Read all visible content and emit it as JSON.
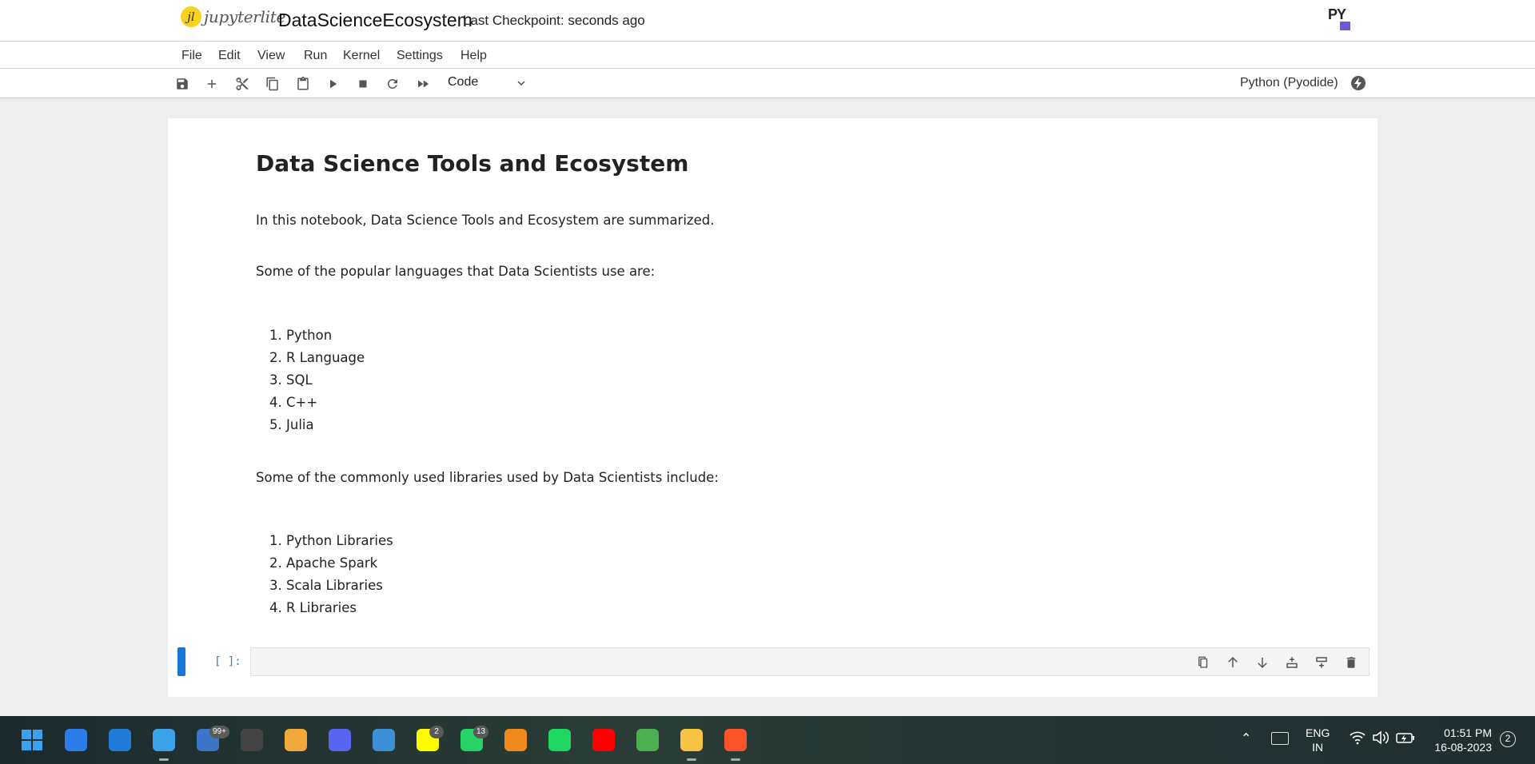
{
  "header": {
    "logo_mark": "jl",
    "logo_text": "jupyterlite",
    "notebook_title": "DataScienceEcosystem",
    "checkpoint": "Last Checkpoint: seconds ago",
    "pyodide_logo": "PY"
  },
  "menu": [
    "File",
    "Edit",
    "View",
    "Run",
    "Kernel",
    "Settings",
    "Help"
  ],
  "toolbar": {
    "buttons": [
      "save-icon",
      "add-icon",
      "cut-icon",
      "copy-icon",
      "paste-icon",
      "run-icon",
      "stop-icon",
      "restart-icon",
      "fast-forward-icon"
    ],
    "cell_type": "Code",
    "kernel": "Python (Pyodide)"
  },
  "notebook": {
    "heading": "Data Science Tools and Ecosystem",
    "intro": "In this notebook, Data Science Tools and Ecosystem are summarized.",
    "languages_intro": "Some of the popular languages that Data Scientists use are:",
    "languages": [
      "Python",
      "R Language",
      "SQL",
      "C++",
      "Julia"
    ],
    "libraries_intro": "Some of the commonly used libraries used by Data Scientists include:",
    "libraries": [
      "Python Libraries",
      "Apache Spark",
      "Scala Libraries",
      "R Libraries"
    ],
    "code_cell_prompt": "[ ]:"
  },
  "taskbar": {
    "apps": [
      {
        "name": "windows-start-icon",
        "color": "#3aa0f0"
      },
      {
        "name": "todo-icon",
        "color": "#2b7de9"
      },
      {
        "name": "mail-icon",
        "color": "#1f7ad9"
      },
      {
        "name": "photos-icon",
        "color": "#3aa3e8"
      },
      {
        "name": "teams-icon",
        "color": "#3c74c8",
        "badge": "99+"
      },
      {
        "name": "game-icon",
        "color": "#444444"
      },
      {
        "name": "video-icon",
        "color": "#f0a83a"
      },
      {
        "name": "discord-icon",
        "color": "#5865f2"
      },
      {
        "name": "remote-desktop-icon",
        "color": "#3d8fd6"
      },
      {
        "name": "snapchat-icon",
        "color": "#fffc00",
        "badge": "2"
      },
      {
        "name": "whatsapp-icon",
        "color": "#25d366",
        "badge": "13"
      },
      {
        "name": "vlc-icon",
        "color": "#f08a1c"
      },
      {
        "name": "spotify-icon",
        "color": "#1ed760"
      },
      {
        "name": "youtube-icon",
        "color": "#ff0000"
      },
      {
        "name": "chrome-icon",
        "color": "#4caf50"
      },
      {
        "name": "file-explorer-icon",
        "color": "#f6c343"
      },
      {
        "name": "brave-icon",
        "color": "#fb542b"
      }
    ],
    "language": "ENG",
    "region": "IN",
    "time": "01:51 PM",
    "date": "16-08-2023",
    "notification_count": "2"
  }
}
